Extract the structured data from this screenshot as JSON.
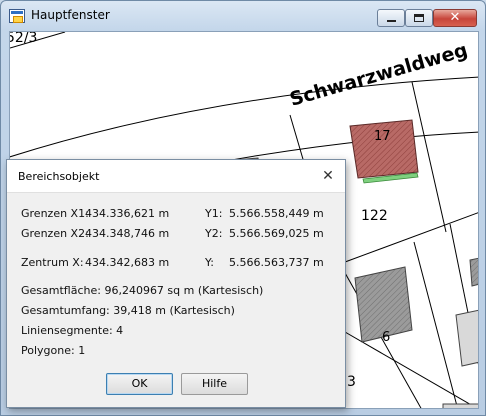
{
  "window": {
    "title": "Hauptfenster",
    "minimize_icon": "minimize-icon",
    "maximize_icon": "maximize-icon",
    "close_icon": "close-icon",
    "close_glyph": "✕"
  },
  "map": {
    "street_name": "Schwarzwaldweg",
    "parcel_partial_top": "52/3",
    "parcel_122": "122",
    "building_17": "17",
    "building_6": "6",
    "partial_bottom": "3",
    "highlight_color": "#b86a66"
  },
  "dialog": {
    "title": "Bereichsobjekt",
    "close_glyph": "✕",
    "grenzen_x1_label": "Grenzen X1:",
    "grenzen_x1_value": "434.336,621 m",
    "y1_label": "Y1:",
    "y1_value": "5.566.558,449 m",
    "grenzen_x2_label": "Grenzen X2:",
    "grenzen_x2_value": "434.348,746 m",
    "y2_label": "Y2:",
    "y2_value": "5.566.569,025 m",
    "zentrum_x_label": "Zentrum X:",
    "zentrum_x_value": "434.342,683 m",
    "zentrum_y_label": "Y:",
    "zentrum_y_value": "5.566.563,737 m",
    "gesamtflaeche": "Gesamtfläche:  96,240967 sq m (Kartesisch)",
    "gesamtumfang": "Gesamtumfang:  39,418 m (Kartesisch)",
    "liniensegmente": "Liniensegmente:  4",
    "polygone": "Polygone:  1",
    "ok_label": "OK",
    "help_label": "Hilfe"
  }
}
